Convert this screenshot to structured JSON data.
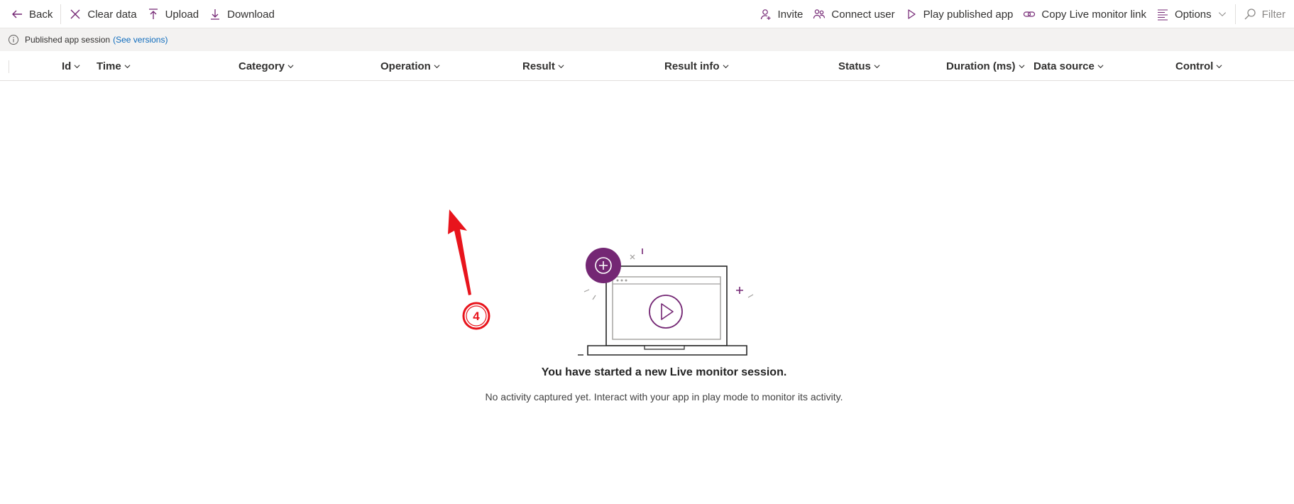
{
  "toolbar": {
    "back": "Back",
    "clear_data": "Clear data",
    "upload": "Upload",
    "download": "Download",
    "invite": "Invite",
    "connect_user": "Connect user",
    "play_published_app": "Play published app",
    "copy_live_monitor_link": "Copy Live monitor link",
    "options": "Options",
    "filter": "Filter"
  },
  "infobar": {
    "text": "Published app session",
    "link": "(See versions)"
  },
  "columns": [
    "Id",
    "Time",
    "Category",
    "Operation",
    "Result",
    "Result info",
    "Status",
    "Duration (ms)",
    "Data source",
    "Control"
  ],
  "empty_state": {
    "title": "You have started a new Live monitor session.",
    "description": "No activity captured yet. Interact with your app in play mode to monitor its activity."
  },
  "annotation": {
    "step_number": "4",
    "color": "#e8141c"
  },
  "colors": {
    "accent": "#742774",
    "text": "#323130",
    "link": "#0f6cbd",
    "infobar_bg": "#f3f2f1"
  },
  "icons": {
    "back": "arrow-left-icon",
    "clear": "x-icon",
    "upload": "upload-icon",
    "download": "download-icon",
    "invite": "person-add-icon",
    "connect_user": "people-icon",
    "play": "play-icon",
    "copy_link": "link-icon",
    "options": "text-align-icon",
    "filter": "search-icon"
  }
}
